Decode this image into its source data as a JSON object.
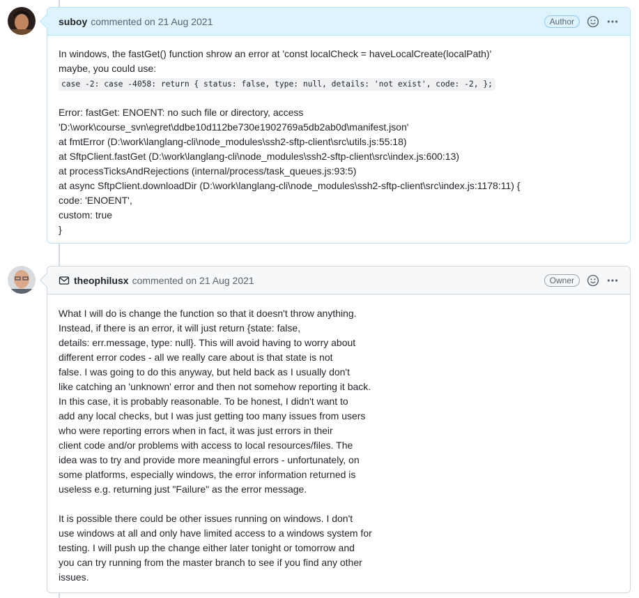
{
  "comments": [
    {
      "username": "suboy",
      "meta": "commented on 21 Aug 2021",
      "role": "Author",
      "lines_a": [
        "In windows, the fastGet() function shrow an error at 'const localCheck = haveLocalCreate(localPath)'",
        "maybe, you could use:"
      ],
      "code": "case -2: case -4058: return { status: false, type: null, details: 'not exist', code: -2, };",
      "lines_b": [
        "Error: fastGet: ENOENT: no such file or directory, access",
        "'D:\\work\\course_svn\\egret\\ddbe10d112be730e1902769a5db2ab0d\\manifest.json'",
        "at fmtError (D:\\work\\langlang-cli\\node_modules\\ssh2-sftp-client\\src\\utils.js:55:18)",
        "at SftpClient.fastGet (D:\\work\\langlang-cli\\node_modules\\ssh2-sftp-client\\src\\index.js:600:13)",
        "at processTicksAndRejections (internal/process/task_queues.js:93:5)",
        "at async SftpClient.downloadDir (D:\\work\\langlang-cli\\node_modules\\ssh2-sftp-client\\src\\index.js:1178:11) {",
        "code: 'ENOENT',",
        "custom: true",
        "}"
      ]
    },
    {
      "username": "theophilusx",
      "meta": "commented on 21 Aug 2021",
      "role": "Owner",
      "para1": [
        "What I will do is change the function so that it doesn't throw anything.",
        "Instead, if there is an error, it will just return {state: false,",
        "details: err.message, type: null}. This will avoid having to worry about",
        "different error codes - all we really care about is that state is not",
        "false. I was going to do this anyway, but held back as I usually don't",
        "like catching an 'unknown' error and then not somehow reporting it back.",
        "In this case, it is probably reasonable. To be honest, I didn't want to",
        "add any local checks, but I was just getting too many issues from users",
        "who were reporting errors when in fact, it was just errors in their",
        "client code and/or problems with access to local resources/files. The",
        "idea was to try and provide more meaningful errors - unfortunately, on",
        "some platforms, especially windows, the error information returned is",
        "useless e.g. returning just \"Failure\" as the error message."
      ],
      "para2": [
        "It is possible there could be other issues running on windows. I don't",
        "use windows at all and only have limited access to a windows system for",
        "testing. I will push up the change either later tonight or tomorrow and",
        "you can try running from the master branch to see if you find any other",
        "issues."
      ]
    }
  ]
}
